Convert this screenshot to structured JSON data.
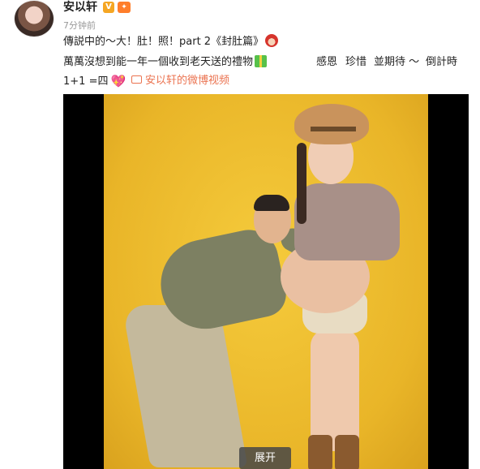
{
  "post": {
    "username": "安以轩",
    "verified_badge": "V",
    "time": "7分钟前",
    "line1": "傳説中的～大！肚！照！part 2《封肚篇》",
    "line2": "萬萬沒想到能一年一個收到老天送的禮物",
    "line2_trailing": [
      "感恩",
      "珍惜",
      "並期待 ～",
      "倒計時"
    ],
    "line3": "1+1 =四",
    "video_link": "安以轩的微博视频",
    "expand_label": "展开"
  },
  "colors": {
    "link": "#eb7350",
    "photo_bg": "#f0c131",
    "media_bg": "#000000"
  },
  "icons": [
    "avatar",
    "verified-v-icon",
    "level-badge-icon",
    "santa-emoji-icon",
    "gift-emoji-icon",
    "heart-emoji-icon",
    "video-camera-icon"
  ]
}
